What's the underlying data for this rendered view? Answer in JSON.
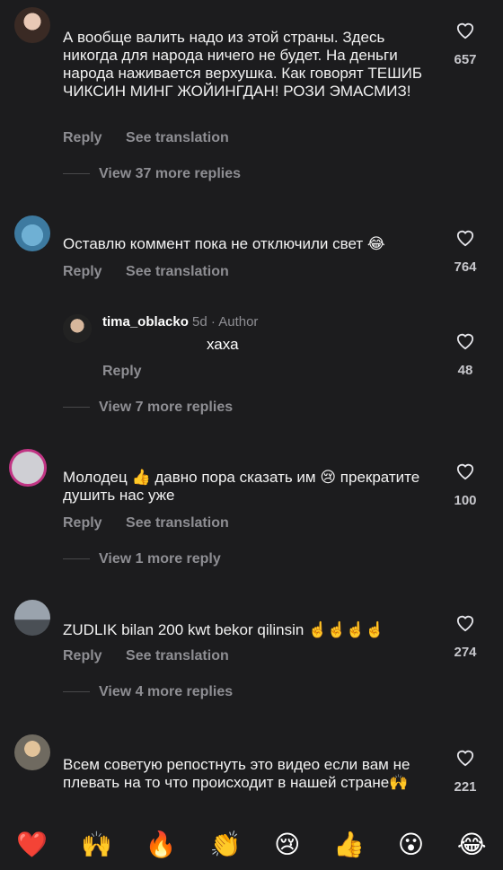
{
  "comments": [
    {
      "text": "А вообще валить надо из этой страны. Здесь никогда для народа ничего не будет. На деньги народа наживается верхушка. Как говорят ТЕШИБ ЧИКСИН МИНГ ЖОЙИНГДАН! РОЗИ ЭМАСМИЗ!",
      "likes": "657",
      "reply": "Reply",
      "translate": "See translation",
      "more": "View 37 more replies"
    },
    {
      "text": "Оставлю коммент пока не отключили свет 😂",
      "likes": "764",
      "reply": "Reply",
      "translate": "See translation"
    },
    {
      "text": "Молодец 👍 давно пора сказать им 😢 прекратите душить нас уже",
      "likes": "100",
      "reply": "Reply",
      "translate": "See translation",
      "more": "View 1 more reply"
    },
    {
      "text": "ZUDLIK bilan 200 kwt bekor qilinsin ☝️☝️☝️☝️",
      "likes": "274",
      "reply": "Reply",
      "translate": "See translation",
      "more": "View 4 more replies"
    },
    {
      "text": "Всем советую репостнуть это видео если вам не плевать на то что происходит в нашей стране🙌",
      "likes": "221"
    }
  ],
  "author_reply": {
    "username": "tima_oblacko",
    "meta": "5d · Author",
    "text": "хаха",
    "likes": "48",
    "reply": "Reply",
    "more": "View 7 more replies"
  },
  "emoji_bar": [
    "❤️",
    "🙌",
    "🔥",
    "👏",
    "😢",
    "👍",
    "😮",
    "😂"
  ]
}
